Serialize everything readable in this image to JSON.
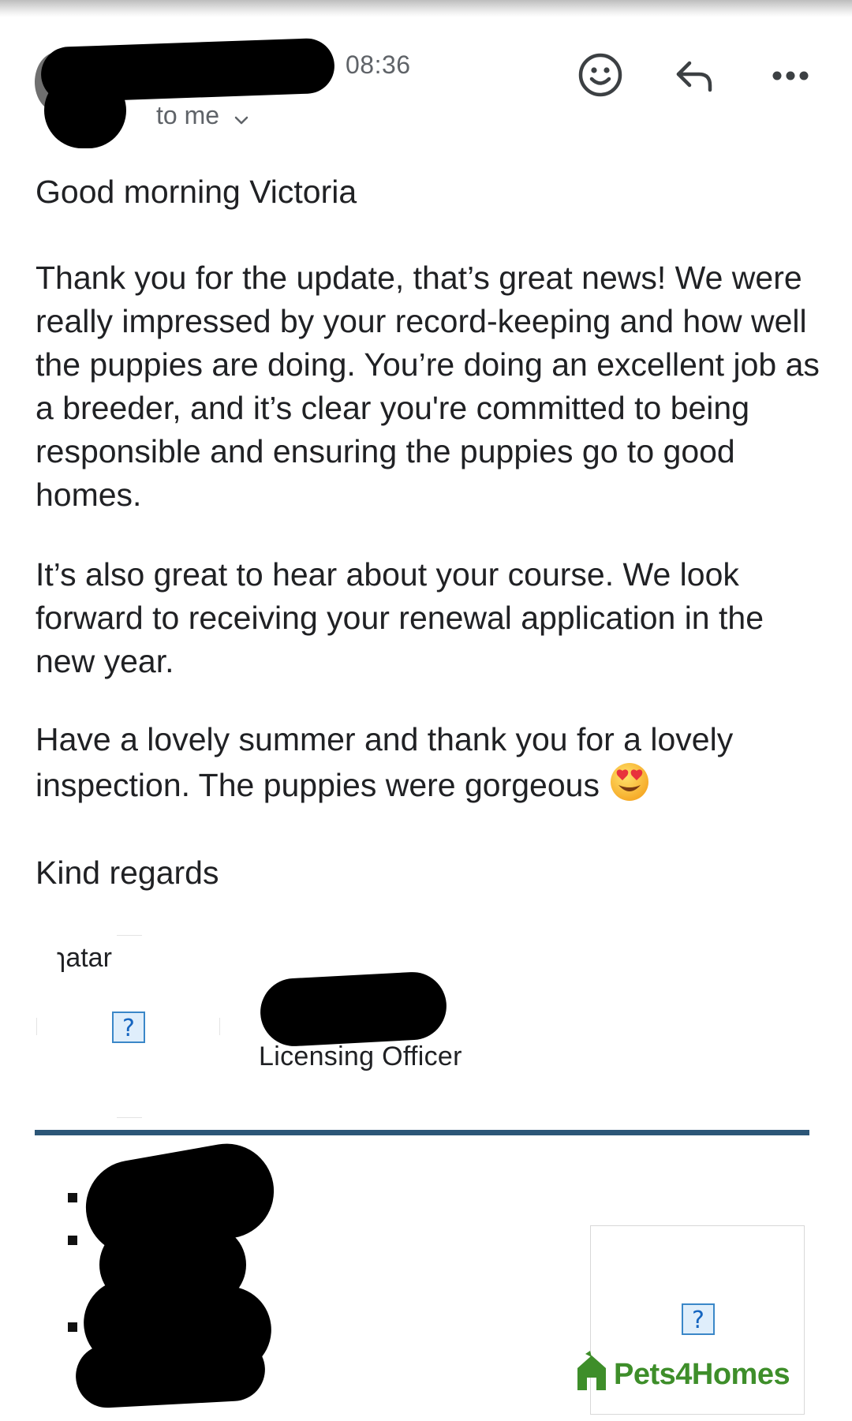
{
  "header": {
    "time": "08:36",
    "recipient_label": "to me"
  },
  "actions": {
    "emoji_icon": "smiley-face-icon",
    "reply_icon": "reply-arrow-icon",
    "more_icon": "more-dots-icon"
  },
  "message": {
    "greeting": "Good morning Victoria",
    "paragraph1": "Thank you for the update, that’s great news! We were really impressed by your record-keeping and how well the puppies are doing. You’re doing an excellent job as a breeder, and it’s clear you're committed to being responsible and ensuring the puppies go to good homes.",
    "paragraph2": "It’s also great to hear about your course. We look forward to receiving your renewal application in the new year.",
    "paragraph3": "Have a lovely summer and thank you for a lovely inspection. The puppies were gorgeous",
    "paragraph3_emoji": "heart-eyes-emoji",
    "closing": "Kind regards"
  },
  "signature": {
    "avatar_alt_fragment": "ɿatar",
    "broken_image_glyph": "?",
    "role": "Licensing Officer",
    "divider_color": "#2c5677"
  },
  "watermark": {
    "text": "Pets4Homes",
    "color": "#3e8e2a"
  }
}
